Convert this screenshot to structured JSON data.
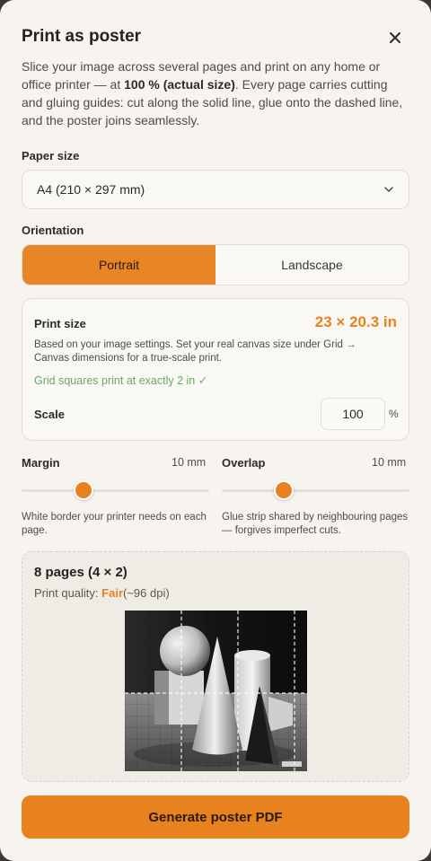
{
  "dialog": {
    "title": "Print as poster",
    "intro_pre": "Slice your image across several pages and print on any home or office printer — at ",
    "intro_bold": "100 % (actual size)",
    "intro_post": ". Every page carries cutting and gluing guides: cut along the solid line, glue onto the dashed line, and the poster joins seamlessly."
  },
  "paper": {
    "label": "Paper size",
    "selected": "A4 (210 × 297 mm)"
  },
  "orientation": {
    "label": "Orientation",
    "options": [
      "Portrait",
      "Landscape"
    ],
    "selected": "Portrait"
  },
  "print_size": {
    "label": "Print size",
    "value": "23 × 20.3 in",
    "description": "Based on your image settings. Set your real canvas size under Grid → Canvas dimensions for a true-scale print.",
    "grid_note": "Grid squares print at exactly 2 in ✓",
    "scale_label": "Scale",
    "scale_value": "100",
    "scale_unit": "%"
  },
  "margin": {
    "label": "Margin",
    "value": "10 mm",
    "level": 0.33,
    "help": "White border your printer needs on each page."
  },
  "overlap": {
    "label": "Overlap",
    "value": "10 mm",
    "level": 0.33,
    "help": "Glue strip shared by neighbouring pages — forgives imperfect cuts."
  },
  "preview": {
    "title": "8 pages (4 × 2)",
    "quality_label": "Print quality: ",
    "quality_value": "Fair",
    "quality_detail": "(~96 dpi)"
  },
  "actions": {
    "generate_label": "Generate poster PDF"
  },
  "colors": {
    "accent": "#e8821e",
    "success": "#6aa86a",
    "background": "#f7f4ef"
  },
  "icons": {
    "close": "close-icon",
    "dropdown": "chevron-down-icon"
  }
}
